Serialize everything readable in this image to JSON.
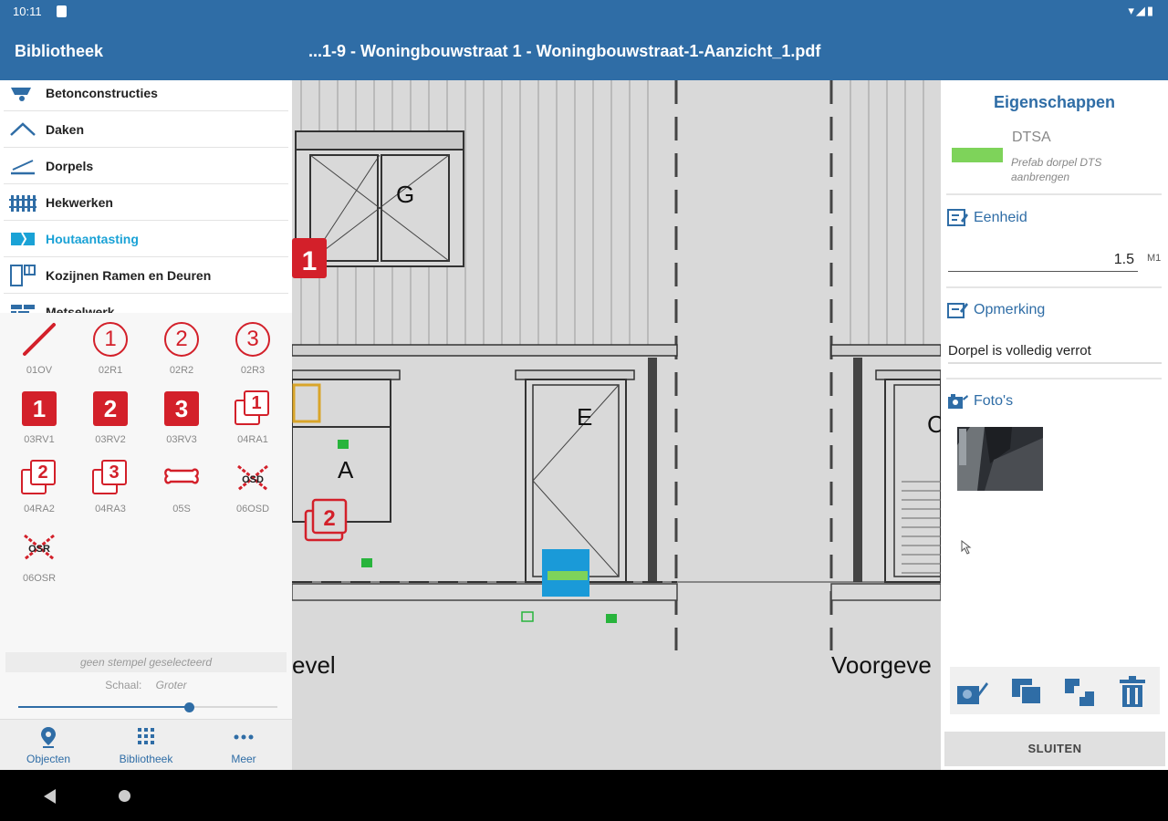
{
  "status_bar": {
    "time": "10:11",
    "icons": "▾◢▮"
  },
  "app_bar": {
    "library_title": "Bibliotheek",
    "document_title": "...1-9 - Woningbouwstraat 1 - Woningbouwstraat-1-Aanzicht_1.pdf"
  },
  "categories": [
    {
      "label": "Betonconstructies",
      "icon": "wheelbarrow-icon"
    },
    {
      "label": "Daken",
      "icon": "roof-icon"
    },
    {
      "label": "Dorpels",
      "icon": "sill-icon"
    },
    {
      "label": "Hekwerken",
      "icon": "fence-icon"
    },
    {
      "label": "Houtaantasting",
      "icon": "wood-damage-icon",
      "active": true
    },
    {
      "label": "Kozijnen Ramen en Deuren",
      "icon": "window-frame-icon"
    },
    {
      "label": "Metselwerk",
      "icon": "brick-icon"
    }
  ],
  "stamps": [
    {
      "code": "01OV",
      "kind": "slash"
    },
    {
      "code": "02R1",
      "kind": "circle",
      "num": "1"
    },
    {
      "code": "02R2",
      "kind": "circle",
      "num": "2"
    },
    {
      "code": "02R3",
      "kind": "circle",
      "num": "3"
    },
    {
      "code": "03RV1",
      "kind": "square",
      "num": "1"
    },
    {
      "code": "03RV2",
      "kind": "square",
      "num": "2"
    },
    {
      "code": "03RV3",
      "kind": "square",
      "num": "3"
    },
    {
      "code": "04RA1",
      "kind": "layer",
      "num": "1"
    },
    {
      "code": "04RA2",
      "kind": "layer",
      "num": "2"
    },
    {
      "code": "04RA3",
      "kind": "layer",
      "num": "3"
    },
    {
      "code": "05S",
      "kind": "bone"
    },
    {
      "code": "06OSD",
      "kind": "cross",
      "num": "OSD"
    },
    {
      "code": "06OSR",
      "kind": "cross",
      "num": "OSR"
    }
  ],
  "stamp_status": "geen stempel geselecteerd",
  "scale": {
    "label": "Schaal:",
    "value": "Groter",
    "level_fraction": 0.66
  },
  "bottom_nav": [
    {
      "label": "Objecten",
      "icon": "map-pin-icon"
    },
    {
      "label": "Bibliotheek",
      "icon": "grid-icon"
    },
    {
      "label": "Meer",
      "icon": "more-dots-icon"
    }
  ],
  "drawing": {
    "labels": {
      "g": "G",
      "e": "E",
      "a": "A",
      "gevel": "evel",
      "voorgevel": "Voorgeve",
      "partial_c": "C"
    },
    "marker_1": "1",
    "marker_2": "2",
    "selected_color": "#1a9ad8",
    "selected_bar_color": "#7ed35a"
  },
  "properties": {
    "title": "Eigenschappen",
    "product_code": "DTSA",
    "product_description": "Prefab dorpel DTS aanbrengen",
    "product_color": "#7ed35a",
    "unit_label": "Eenheid",
    "unit_value": "1.5",
    "unit_suffix": "M1",
    "remark_label": "Opmerking",
    "remark_value": "Dorpel is volledig verrot",
    "photos_label": "Foto's",
    "close_label": "SLUITEN"
  },
  "colors": {
    "primary": "#2f6da6",
    "accent": "#1aa2d6",
    "stamp_red": "#d3202a"
  }
}
